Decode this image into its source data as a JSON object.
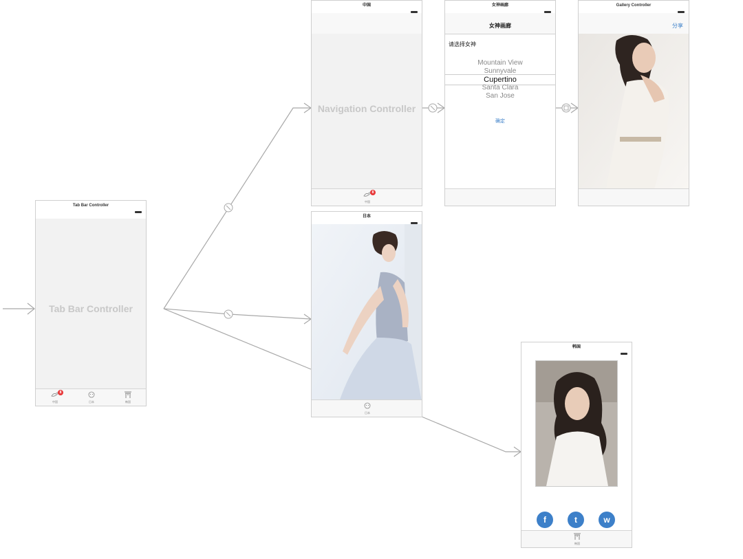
{
  "tab_bar_controller": {
    "title": "Tab Bar Controller",
    "placeholder": "Tab Bar Controller",
    "tabs": [
      {
        "label": "中国",
        "badge": "8",
        "icon": "bird-icon"
      },
      {
        "label": "日本",
        "icon": "face-icon"
      },
      {
        "label": "韩国",
        "icon": "gate-icon"
      }
    ]
  },
  "navigation_controller": {
    "title": "中国",
    "placeholder": "Navigation Controller",
    "tab_label": "中国",
    "tab_badge": "8"
  },
  "picker_scene": {
    "title": "女神画廊",
    "nav_title": "女神画廊",
    "prompt": "请选择女神",
    "picker_items": [
      "Mountain View",
      "Sunnyvale",
      "Cupertino",
      "Santa Clara",
      "San Jose"
    ],
    "selected_item": "Cupertino",
    "confirm_label": "确定"
  },
  "gallery_controller": {
    "title": "Gallery Controller",
    "share_label": "分享"
  },
  "japan_scene": {
    "title": "日本",
    "tab_label": "日本"
  },
  "korea_scene": {
    "title": "韩国",
    "tab_label": "韩国",
    "social_buttons": [
      {
        "glyph": "f",
        "icon": "facebook-icon"
      },
      {
        "glyph": "t",
        "icon": "twitter-icon"
      },
      {
        "glyph": "w",
        "icon": "weibo-icon"
      }
    ]
  },
  "colors": {
    "accent": "#3d80c9",
    "badge": "#e8383a",
    "placeholder_text": "#c8c8c8",
    "segue_line": "#a0a0a0"
  }
}
